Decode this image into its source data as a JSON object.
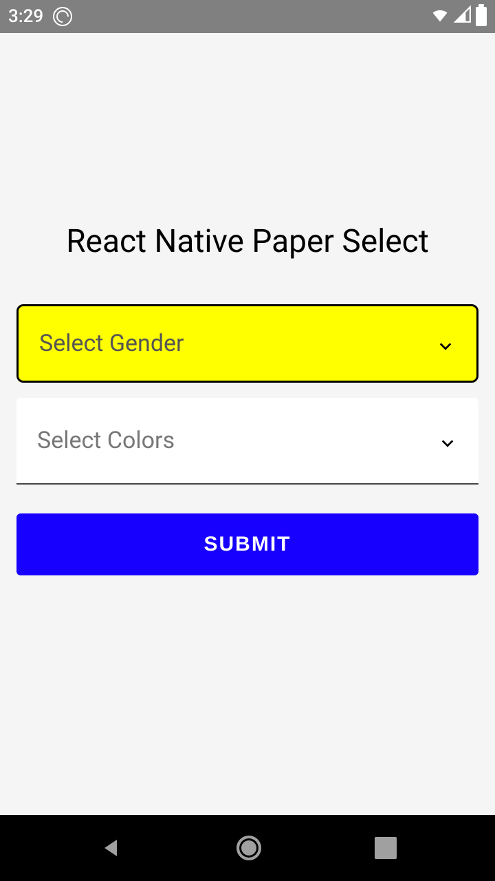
{
  "statusBar": {
    "time": "3:29"
  },
  "page": {
    "title": "React Native Paper Select"
  },
  "selects": {
    "gender": {
      "placeholder": "Select Gender"
    },
    "colors": {
      "placeholder": "Select Colors"
    }
  },
  "buttons": {
    "submit": "SUBMIT"
  },
  "colors": {
    "accent": "#ffff00",
    "primary": "#1800ff"
  }
}
